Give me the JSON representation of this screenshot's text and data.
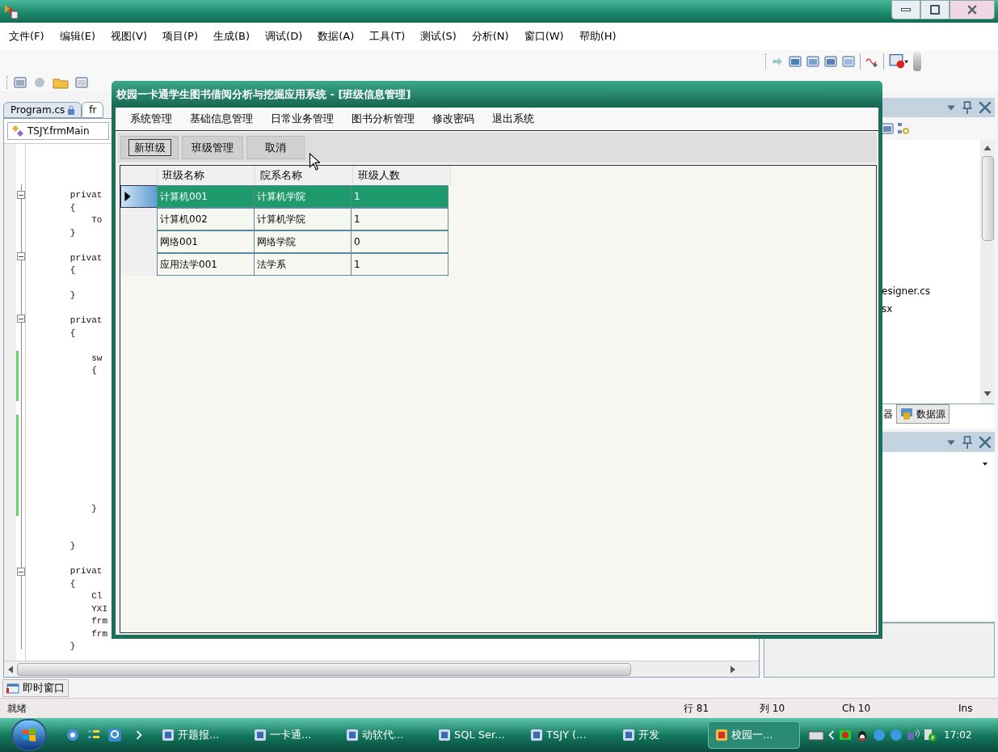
{
  "ide": {
    "menu": [
      "文件(F)",
      "编辑(E)",
      "视图(V)",
      "项目(P)",
      "生成(B)",
      "调试(D)",
      "数据(A)",
      "工具(T)",
      "测试(S)",
      "分析(N)",
      "窗口(W)",
      "帮助(H)"
    ],
    "document_tabs": [
      {
        "label": "Program.cs",
        "selected": false
      },
      {
        "label": "fr",
        "selected": true
      }
    ],
    "class_selector": "TSJY.frmMain",
    "code": "        privat\n        {\n            To\n        }\n\n        privat\n        {\n\n        }\n\n        privat\n        {\n\n            sw\n            {\n\n\n\n\n\n\n\n\n\n\n            }\n\n\n        }\n\n        privat\n        {\n            Cl\n            YXI\n            frm\n            frm\n        }",
    "right_panel": {
      "items": [
        "esigner.cs",
        "sx"
      ],
      "tabs": [
        {
          "label": "器",
          "selected": false
        },
        {
          "label": "数据源",
          "selected": true
        }
      ]
    },
    "bottom_tab": "即时窗口",
    "status_bar": {
      "text": "就绪",
      "line": "行 81",
      "column": "列 10",
      "char": "Ch 10",
      "mode": "Ins"
    }
  },
  "form": {
    "title": "校园一卡通学生图书借阅分析与挖掘应用系统 - [班级信息管理]",
    "menu": [
      "系统管理",
      "基础信息管理",
      "日常业务管理",
      "图书分析管理",
      "修改密码",
      "退出系统"
    ],
    "buttons": [
      {
        "label": "新班级",
        "focused": true
      },
      {
        "label": "班级管理",
        "focused": false
      },
      {
        "label": "取消",
        "focused": false
      }
    ],
    "table": {
      "columns": [
        "班级名称",
        "院系名称",
        "班级人数"
      ],
      "rows": [
        {
          "cells": [
            "计算机001",
            "计算机学院",
            "1"
          ],
          "selected": true
        },
        {
          "cells": [
            "计算机002",
            "计算机学院",
            "1"
          ],
          "selected": false
        },
        {
          "cells": [
            "网络001",
            "网络学院",
            "0"
          ],
          "selected": false
        },
        {
          "cells": [
            "应用法学001",
            "法学系",
            "1"
          ],
          "selected": false
        }
      ]
    }
  },
  "taskbar": {
    "tasks": [
      {
        "label": "开题报...",
        "active": false
      },
      {
        "label": "一卡通...",
        "active": false
      },
      {
        "label": "动软代...",
        "active": false
      },
      {
        "label": "SQL Ser...",
        "active": false
      },
      {
        "label": "TSJY (...",
        "active": false
      },
      {
        "label": "开发",
        "active": false
      },
      {
        "label": "校园一...",
        "active": true
      }
    ],
    "clock": "17:02"
  }
}
